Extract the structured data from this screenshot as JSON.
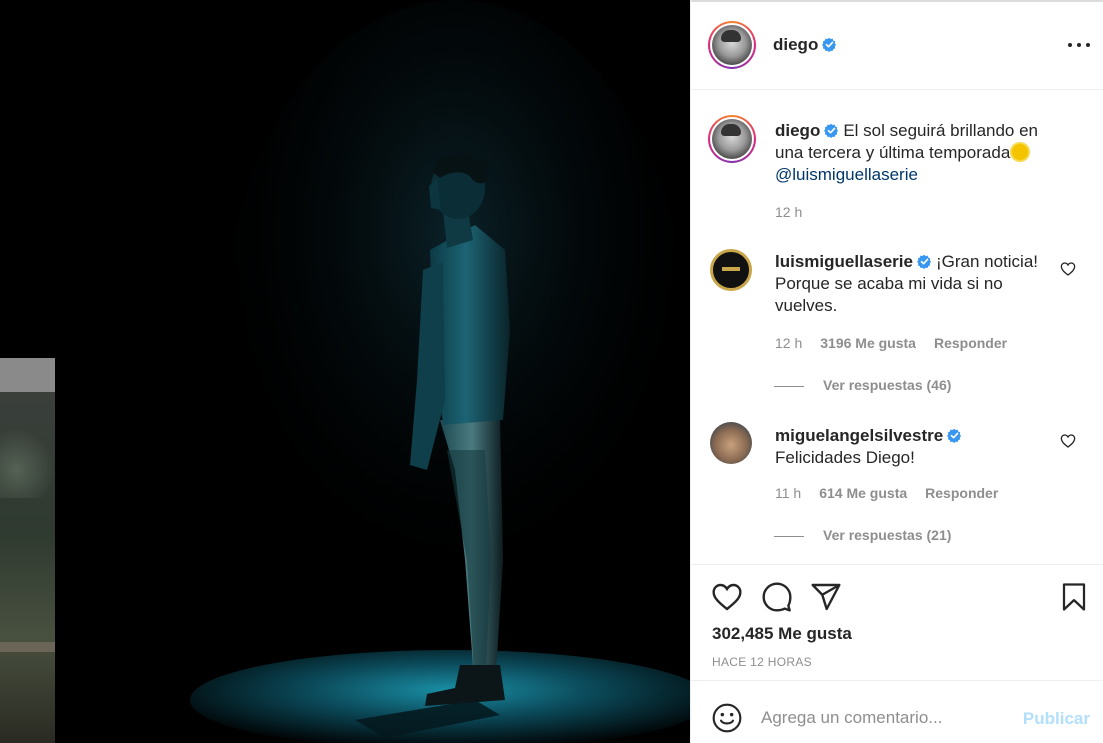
{
  "post": {
    "username": "diego",
    "verified": true
  },
  "caption": {
    "username": "diego",
    "text": "El sol seguirá brillando en una tercera y última temporada",
    "emoji": "sun-emoji",
    "mention": "@luismiguellaserie",
    "time": "12 h"
  },
  "comments": [
    {
      "username": "luismiguellaserie",
      "text": "¡Gran noticia! Porque se acaba mi vida si no vuelves.",
      "time": "12 h",
      "likes": "3196 Me gusta",
      "reply": "Responder",
      "view_replies": "Ver respuestas (46)"
    },
    {
      "username": "miguelangelsilvestre",
      "text": "Felicidades Diego!",
      "time": "11 h",
      "likes": "614 Me gusta",
      "reply": "Responder",
      "view_replies": "Ver respuestas (21)"
    }
  ],
  "actions": {
    "likes_total": "302,485 Me gusta",
    "time_ago": "HACE 12 HORAS"
  },
  "add_comment": {
    "placeholder": "Agrega un comentario...",
    "publish": "Publicar"
  },
  "colors": {
    "verified": "#3897f0",
    "link": "#00376b",
    "publish_disabled": "#b2dffc",
    "muted": "#8e8e8e"
  }
}
